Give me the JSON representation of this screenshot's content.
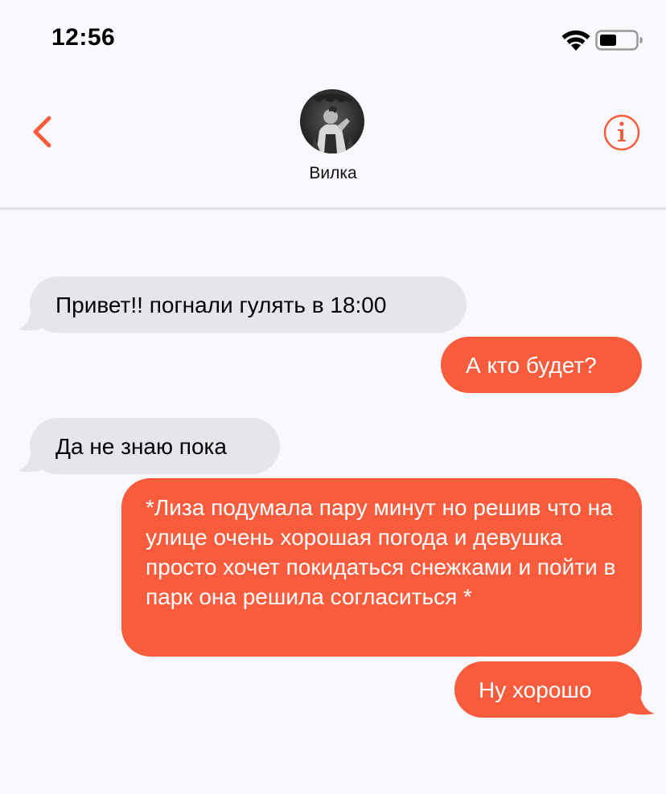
{
  "status_bar": {
    "time": "12:56"
  },
  "header": {
    "contact_name": "Вилка",
    "back_icon": "chevron-left-icon",
    "info_icon": "info-icon",
    "accent_color": "#f85c3d"
  },
  "messages": [
    {
      "direction": "incoming",
      "text": "Привет!! погнали гулять в 18:00"
    },
    {
      "direction": "outgoing",
      "text": "А кто будет?"
    },
    {
      "direction": "incoming",
      "text": "Да не знаю пока"
    },
    {
      "direction": "outgoing",
      "text": "*Лиза подумала пару минут но решив что на улице очень хорошая погода и девушка просто хочет покидаться снежками и пойти в парк она решила согласиться *"
    },
    {
      "direction": "outgoing",
      "text": "Ну хорошо"
    }
  ],
  "colors": {
    "outgoing_bubble": "#f85c3d",
    "incoming_bubble": "#e6e5ec",
    "background": "#f9f8fc"
  }
}
